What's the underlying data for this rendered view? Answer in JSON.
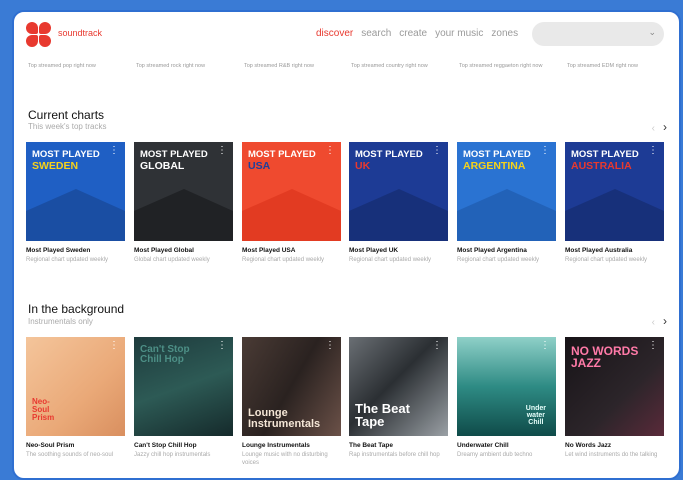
{
  "app": {
    "brand": "soundtrack"
  },
  "nav": [
    {
      "label": "discover",
      "active": true
    },
    {
      "label": "search",
      "active": false
    },
    {
      "label": "create",
      "active": false
    },
    {
      "label": "your music",
      "active": false
    },
    {
      "label": "zones",
      "active": false
    }
  ],
  "genres": [
    "Top streamed pop right now",
    "Top streamed rock right now",
    "Top streamed R&B right now",
    "Top streamed country right now",
    "Top streamed reggaeton right now",
    "Top streamed EDM right now"
  ],
  "charts": {
    "title": "Current charts",
    "subtitle": "This week's top tracks",
    "cards": [
      {
        "label": "MOST PLAYED",
        "country": "SWEDEN",
        "title": "Most Played Sweden",
        "desc": "Regional chart updated weekly",
        "bg": "#1f5fc4",
        "mount": "#1a4ea3",
        "countryColor": "#f6d21a"
      },
      {
        "label": "MOST PLAYED",
        "country": "GLOBAL",
        "title": "Most Played Global",
        "desc": "Global chart updated weekly",
        "bg": "#2f3236",
        "mount": "#202225",
        "countryColor": "#ffffff"
      },
      {
        "label": "MOST PLAYED",
        "country": "USA",
        "title": "Most Played USA",
        "desc": "Regional chart updated weekly",
        "bg": "#ef4a2f",
        "mount": "#e23b22",
        "countryColor": "#1e3f9c"
      },
      {
        "label": "MOST PLAYED",
        "country": "UK",
        "title": "Most Played UK",
        "desc": "Regional chart updated weekly",
        "bg": "#1d3b95",
        "mount": "#17307a",
        "countryColor": "#e8392f"
      },
      {
        "label": "MOST PLAYED",
        "country": "ARGENTINA",
        "title": "Most Played Argentina",
        "desc": "Regional chart updated weekly",
        "bg": "#2a73d2",
        "mount": "#2262b8",
        "countryColor": "#f6d21a"
      },
      {
        "label": "MOST PLAYED",
        "country": "AUSTRALIA",
        "title": "Most Played Australia",
        "desc": "Regional chart updated weekly",
        "bg": "#1d3b95",
        "mount": "#17307a",
        "countryColor": "#e8392f"
      }
    ]
  },
  "background": {
    "title": "In the background",
    "subtitle": "Instrumentals only",
    "cards": [
      {
        "art_text": "Neo-\nSoul\nPrism",
        "title": "Neo-Soul Prism",
        "desc": "The soothing sounds of neo-soul"
      },
      {
        "art_text": "Can't Stop\nChill Hop",
        "title": "Can't Stop Chill Hop",
        "desc": "Jazzy chill hop instrumentals"
      },
      {
        "art_text": "Lounge\nInstrumentals",
        "title": "Lounge Instrumentals",
        "desc": "Lounge music with no disturbing voices"
      },
      {
        "art_text": "The Beat\nTape",
        "title": "The Beat Tape",
        "desc": "Rap instrumentals before chill hop"
      },
      {
        "art_text": "Under\nwater\nChill",
        "title": "Underwater Chill",
        "desc": "Dreamy ambient dub techno"
      },
      {
        "art_text": "NO WORDS\nJAZZ",
        "title": "No Words Jazz",
        "desc": "Let wind instruments do the talking"
      }
    ]
  },
  "colors": {
    "accent": "#e8392f",
    "frame": "#2f6fd1"
  },
  "icons": {
    "menu": "⋮",
    "prev": "‹",
    "next": "›",
    "dropdown": "⌄"
  }
}
